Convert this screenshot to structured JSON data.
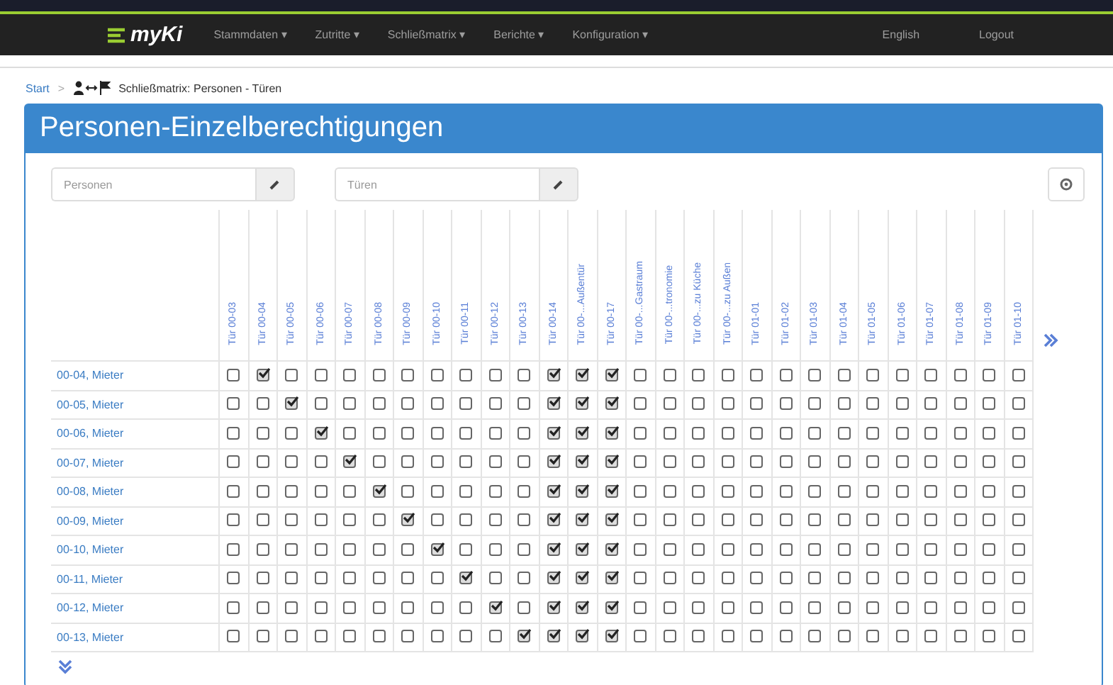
{
  "navbar": {
    "brand": "myKi",
    "menus": [
      {
        "label": "Stammdaten",
        "caret": "▾"
      },
      {
        "label": "Zutritte",
        "caret": "▾"
      },
      {
        "label": "Schließmatrix",
        "caret": "▾"
      },
      {
        "label": "Berichte",
        "caret": "▾"
      },
      {
        "label": "Konfiguration",
        "caret": "▾"
      }
    ],
    "right": [
      "English",
      "Logout"
    ]
  },
  "breadcrumb": {
    "home": "Start",
    "separator": ">",
    "current": "Schließmatrix: Personen - Türen"
  },
  "panel": {
    "title": "Personen-Einzelberechtigungen",
    "filters": [
      {
        "placeholder": "Personen"
      },
      {
        "placeholder": "Türen"
      }
    ],
    "table": {
      "columns": [
        "Tür 00-03",
        "Tür 00-04",
        "Tür 00-05",
        "Tür 00-06",
        "Tür 00-07",
        "Tür 00-08",
        "Tür 00-09",
        "Tür 00-10",
        "Tür 00-11",
        "Tür 00-12",
        "Tür 00-13",
        "Tür 00-14",
        "Tür 00-...Außentür",
        "Tür 00-17",
        "Tür 00-...Gastraum",
        "Tür 00-...tronomie",
        "Tür 00-...zu Küche",
        "Tür 00-...zu Außen",
        "Tür 01-01",
        "Tür 01-02",
        "Tür 01-03",
        "Tür 01-04",
        "Tür 01-05",
        "Tür 01-06",
        "Tür 01-07",
        "Tür 01-08",
        "Tür 01-09",
        "Tür 01-10"
      ],
      "rows": [
        {
          "name": "00-04, Mieter",
          "checked": [
            false,
            true,
            false,
            false,
            false,
            false,
            false,
            false,
            false,
            false,
            false,
            true,
            true,
            true,
            false,
            false,
            false,
            false,
            false,
            false,
            false,
            false,
            false,
            false,
            false,
            false,
            false,
            false
          ]
        },
        {
          "name": "00-05, Mieter",
          "checked": [
            false,
            false,
            true,
            false,
            false,
            false,
            false,
            false,
            false,
            false,
            false,
            true,
            true,
            true,
            false,
            false,
            false,
            false,
            false,
            false,
            false,
            false,
            false,
            false,
            false,
            false,
            false,
            false
          ]
        },
        {
          "name": "00-06, Mieter",
          "checked": [
            false,
            false,
            false,
            true,
            false,
            false,
            false,
            false,
            false,
            false,
            false,
            true,
            true,
            true,
            false,
            false,
            false,
            false,
            false,
            false,
            false,
            false,
            false,
            false,
            false,
            false,
            false,
            false
          ]
        },
        {
          "name": "00-07, Mieter",
          "checked": [
            false,
            false,
            false,
            false,
            true,
            false,
            false,
            false,
            false,
            false,
            false,
            true,
            true,
            true,
            false,
            false,
            false,
            false,
            false,
            false,
            false,
            false,
            false,
            false,
            false,
            false,
            false,
            false
          ]
        },
        {
          "name": "00-08, Mieter",
          "checked": [
            false,
            false,
            false,
            false,
            false,
            true,
            false,
            false,
            false,
            false,
            false,
            true,
            true,
            true,
            false,
            false,
            false,
            false,
            false,
            false,
            false,
            false,
            false,
            false,
            false,
            false,
            false,
            false
          ]
        },
        {
          "name": "00-09, Mieter",
          "checked": [
            false,
            false,
            false,
            false,
            false,
            false,
            true,
            false,
            false,
            false,
            false,
            true,
            true,
            true,
            false,
            false,
            false,
            false,
            false,
            false,
            false,
            false,
            false,
            false,
            false,
            false,
            false,
            false
          ]
        },
        {
          "name": "00-10, Mieter",
          "checked": [
            false,
            false,
            false,
            false,
            false,
            false,
            false,
            true,
            false,
            false,
            false,
            true,
            true,
            true,
            false,
            false,
            false,
            false,
            false,
            false,
            false,
            false,
            false,
            false,
            false,
            false,
            false,
            false
          ]
        },
        {
          "name": "00-11, Mieter",
          "checked": [
            false,
            false,
            false,
            false,
            false,
            false,
            false,
            false,
            true,
            false,
            false,
            true,
            true,
            true,
            false,
            false,
            false,
            false,
            false,
            false,
            false,
            false,
            false,
            false,
            false,
            false,
            false,
            false
          ]
        },
        {
          "name": "00-12, Mieter",
          "checked": [
            false,
            false,
            false,
            false,
            false,
            false,
            false,
            false,
            false,
            true,
            false,
            true,
            true,
            true,
            false,
            false,
            false,
            false,
            false,
            false,
            false,
            false,
            false,
            false,
            false,
            false,
            false,
            false
          ]
        },
        {
          "name": "00-13, Mieter",
          "checked": [
            false,
            false,
            false,
            false,
            false,
            false,
            false,
            false,
            false,
            false,
            true,
            true,
            true,
            true,
            false,
            false,
            false,
            false,
            false,
            false,
            false,
            false,
            false,
            false,
            false,
            false,
            false,
            false
          ]
        }
      ]
    }
  }
}
